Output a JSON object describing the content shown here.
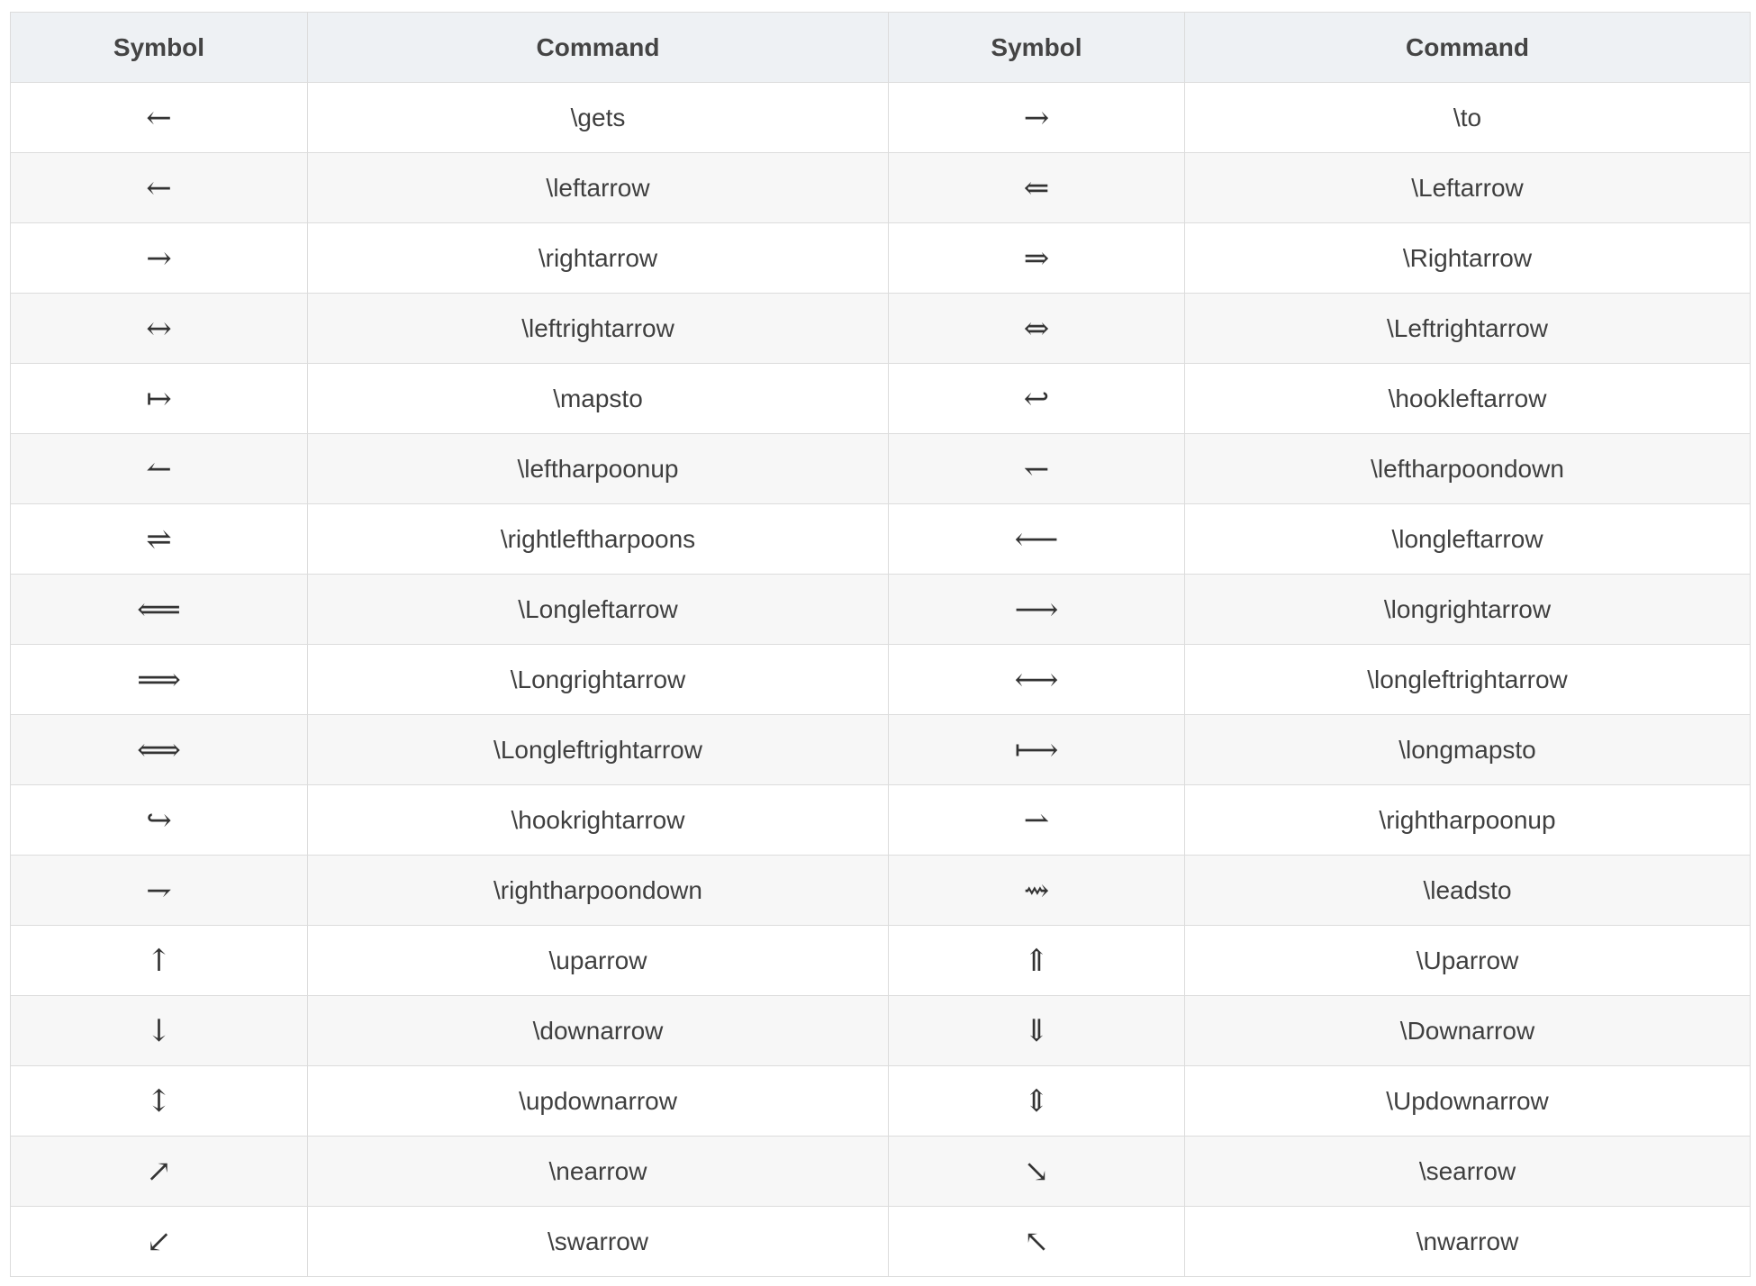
{
  "table": {
    "headers": [
      "Symbol",
      "Command",
      "Symbol",
      "Command"
    ],
    "rows": [
      [
        {
          "symbol": "←",
          "icon": "gets-arrow-icon",
          "command": "\\gets"
        },
        {
          "symbol": "→",
          "icon": "to-arrow-icon",
          "command": "\\to"
        }
      ],
      [
        {
          "symbol": "←",
          "icon": "leftarrow-icon",
          "command": "\\leftarrow"
        },
        {
          "symbol": "⇐",
          "icon": "double-leftarrow-icon",
          "command": "\\Leftarrow"
        }
      ],
      [
        {
          "symbol": "→",
          "icon": "rightarrow-icon",
          "command": "\\rightarrow"
        },
        {
          "symbol": "⇒",
          "icon": "double-rightarrow-icon",
          "command": "\\Rightarrow"
        }
      ],
      [
        {
          "symbol": "↔",
          "icon": "leftrightarrow-icon",
          "command": "\\leftrightarrow"
        },
        {
          "symbol": "⇔",
          "icon": "double-leftrightarrow-icon",
          "command": "\\Leftrightarrow"
        }
      ],
      [
        {
          "symbol": "↦",
          "icon": "mapsto-icon",
          "command": "\\mapsto"
        },
        {
          "symbol": "↩",
          "icon": "hookleftarrow-icon",
          "command": "\\hookleftarrow"
        }
      ],
      [
        {
          "symbol": "↼",
          "icon": "leftharpoonup-icon",
          "command": "\\leftharpoonup"
        },
        {
          "symbol": "↽",
          "icon": "leftharpoondown-icon",
          "command": "\\leftharpoondown"
        }
      ],
      [
        {
          "symbol": "⇌",
          "icon": "rightleftharpoons-icon",
          "command": "\\rightleftharpoons"
        },
        {
          "symbol": "⟵",
          "icon": "longleftarrow-icon",
          "command": "\\longleftarrow"
        }
      ],
      [
        {
          "symbol": "⟸",
          "icon": "double-longleftarrow-icon",
          "command": "\\Longleftarrow"
        },
        {
          "symbol": "⟶",
          "icon": "longrightarrow-icon",
          "command": "\\longrightarrow"
        }
      ],
      [
        {
          "symbol": "⟹",
          "icon": "double-longrightarrow-icon",
          "command": "\\Longrightarrow"
        },
        {
          "symbol": "⟷",
          "icon": "longleftrightarrow-icon",
          "command": "\\longleftrightarrow"
        }
      ],
      [
        {
          "symbol": "⟺",
          "icon": "double-longleftrightarrow-icon",
          "command": "\\Longleftrightarrow"
        },
        {
          "symbol": "⟼",
          "icon": "longmapsto-icon",
          "command": "\\longmapsto"
        }
      ],
      [
        {
          "symbol": "↪",
          "icon": "hookrightarrow-icon",
          "command": "\\hookrightarrow"
        },
        {
          "symbol": "⇀",
          "icon": "rightharpoonup-icon",
          "command": "\\rightharpoonup"
        }
      ],
      [
        {
          "symbol": "⇁",
          "icon": "rightharpoondown-icon",
          "command": "\\rightharpoondown"
        },
        {
          "symbol": "⇝",
          "icon": "leadsto-icon",
          "command": "\\leadsto"
        }
      ],
      [
        {
          "symbol": "↑",
          "icon": "uparrow-icon",
          "command": "\\uparrow"
        },
        {
          "symbol": "⇑",
          "icon": "double-uparrow-icon",
          "command": "\\Uparrow"
        }
      ],
      [
        {
          "symbol": "↓",
          "icon": "downarrow-icon",
          "command": "\\downarrow"
        },
        {
          "symbol": "⇓",
          "icon": "double-downarrow-icon",
          "command": "\\Downarrow"
        }
      ],
      [
        {
          "symbol": "↕",
          "icon": "updownarrow-icon",
          "command": "\\updownarrow"
        },
        {
          "symbol": "⇕",
          "icon": "double-updownarrow-icon",
          "command": "\\Updownarrow"
        }
      ],
      [
        {
          "symbol": "↗",
          "icon": "nearrow-icon",
          "command": "\\nearrow"
        },
        {
          "symbol": "↘",
          "icon": "searrow-icon",
          "command": "\\searrow"
        }
      ],
      [
        {
          "symbol": "↙",
          "icon": "swarrow-icon",
          "command": "\\swarrow"
        },
        {
          "symbol": "↖",
          "icon": "nwarrow-icon",
          "command": "\\nwarrow"
        }
      ]
    ]
  }
}
